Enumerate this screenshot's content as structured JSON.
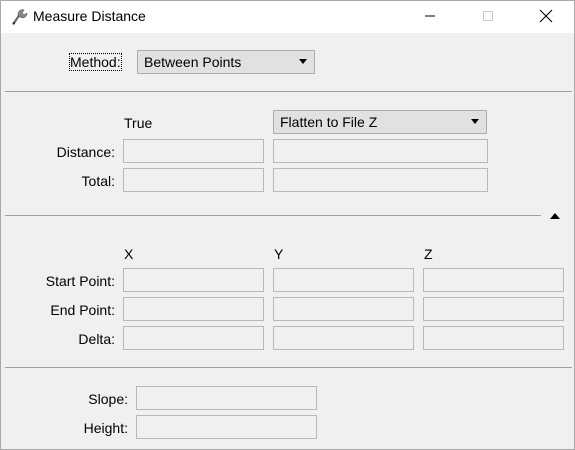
{
  "window": {
    "title": "Measure Distance"
  },
  "method": {
    "label": "Method:",
    "value": "Between Points"
  },
  "distance_section": {
    "true_header": "True",
    "flatten_value": "Flatten to File Z",
    "distance_label": "Distance:",
    "total_label": "Total:"
  },
  "points_section": {
    "x_header": "X",
    "y_header": "Y",
    "z_header": "Z",
    "start_label": "Start Point:",
    "end_label": "End Point:",
    "delta_label": "Delta:"
  },
  "slope_section": {
    "slope_label": "Slope:",
    "height_label": "Height:"
  },
  "icons": {
    "app": "measure-tool-icon",
    "minimize": "minimize-icon",
    "maximize": "maximize-icon",
    "close": "close-icon",
    "collapse": "collapse-arrow-icon"
  }
}
